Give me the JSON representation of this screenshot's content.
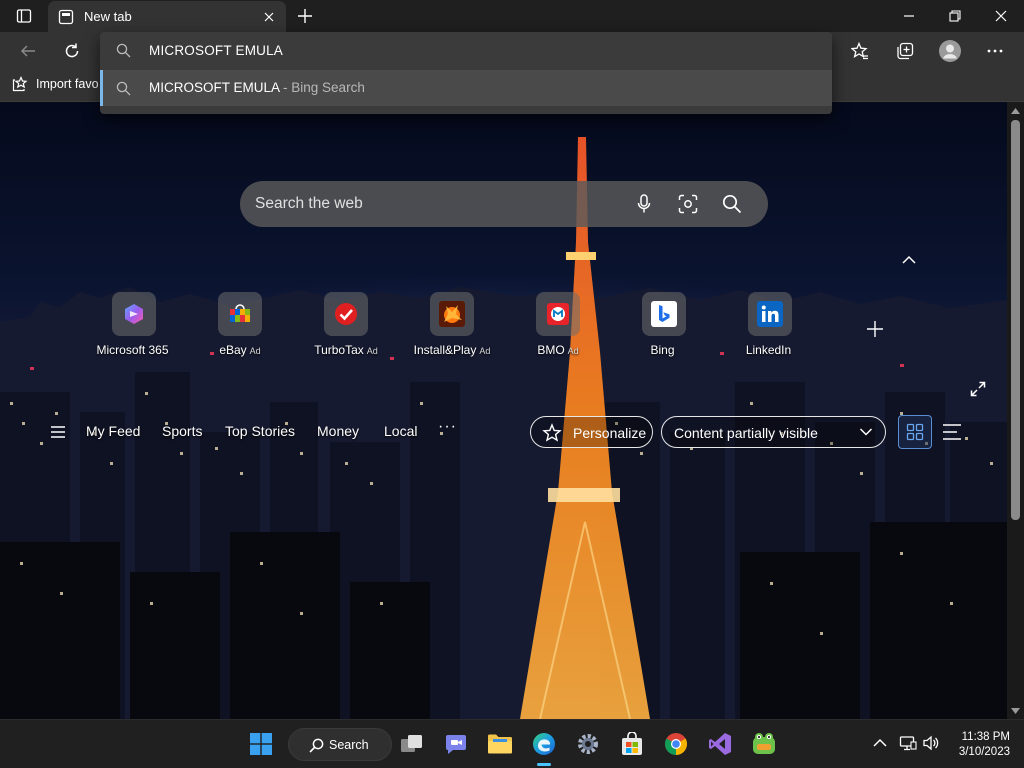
{
  "browser": {
    "tab_title": "New tab",
    "address_text": "MICROSOFT EMULA",
    "suggestion": {
      "query": "MICROSOFT EMULA",
      "source": " - Bing Search"
    },
    "favorites_bar": {
      "import_label": "Import favo"
    },
    "icons": [
      "tab-actions-icon",
      "new-tab-icon",
      "close-icon",
      "minimize-icon",
      "restore-icon",
      "back-icon",
      "refresh-icon",
      "favorites-icon",
      "collections-icon",
      "profile-icon",
      "more-icon"
    ]
  },
  "newtab": {
    "search_placeholder": "Search the web",
    "quick_links": [
      {
        "label": "Microsoft 365",
        "ad": ""
      },
      {
        "label": "eBay",
        "ad": "Ad"
      },
      {
        "label": "TurboTax",
        "ad": "Ad"
      },
      {
        "label": "Install&Play",
        "ad": "Ad"
      },
      {
        "label": "BMO",
        "ad": "Ad"
      },
      {
        "label": "Bing",
        "ad": ""
      },
      {
        "label": "LinkedIn",
        "ad": ""
      }
    ],
    "feed_nav": {
      "items": [
        "My Feed",
        "Sports",
        "Top Stories",
        "Money",
        "Local"
      ],
      "more": "···",
      "personalize": "Personalize",
      "content_visibility": "Content partially visible"
    }
  },
  "taskbar": {
    "search_label": "Search",
    "time": "11:38 PM",
    "date": "3/10/2023"
  },
  "colors": {
    "accent": "#4cc2ff",
    "suggest_highlight": "#7cb7ea",
    "tab_bg": "#333333",
    "chrome_bg": "#1f1f1f"
  }
}
